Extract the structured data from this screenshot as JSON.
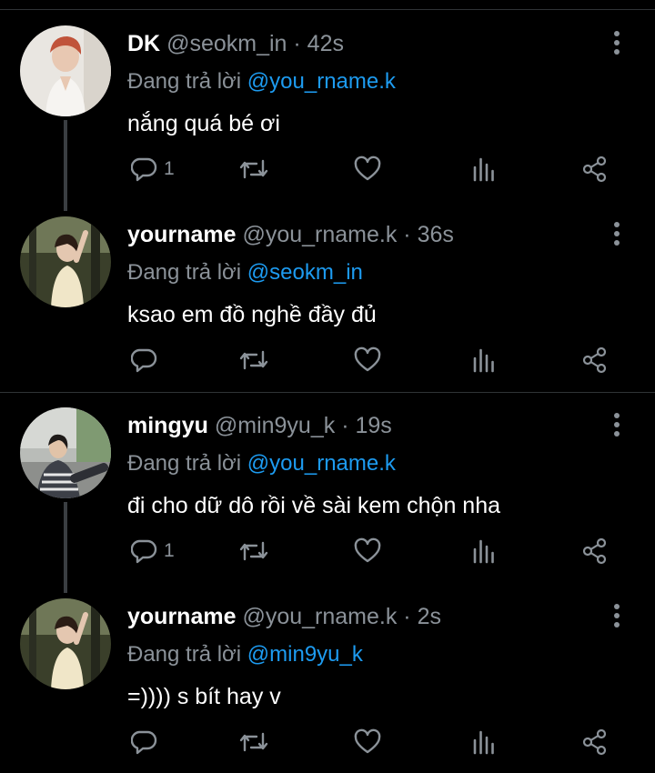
{
  "colors": {
    "background": "#000000",
    "muted": "#8b9299",
    "mention": "#1d9bf0",
    "divider": "#2f3336"
  },
  "tweets": [
    {
      "name": "DK",
      "handle": "@seokm_in",
      "time": "· 42s",
      "reply_prefix": "Đang trả lời",
      "reply_to": "@you_rname.k",
      "text": "nắng quá bé ơi",
      "reply_count": "1",
      "avatar": "avatar-dk"
    },
    {
      "name": "yourname",
      "handle": "@you_rname.k",
      "time": "· 36s",
      "reply_prefix": "Đang trả lời",
      "reply_to": "@seokm_in",
      "text": "ksao em đồ nghề đầy đủ",
      "reply_count": "",
      "avatar": "avatar-yourname"
    },
    {
      "name": "mingyu",
      "handle": "@min9yu_k",
      "time": "· 19s",
      "reply_prefix": "Đang trả lời",
      "reply_to": "@you_rname.k",
      "text": "đi cho dữ dô rồi về sài kem chộn nha",
      "reply_count": "1",
      "avatar": "avatar-mingyu"
    },
    {
      "name": "yourname",
      "handle": "@you_rname.k",
      "time": "· 2s",
      "reply_prefix": "Đang trả lời",
      "reply_to": "@min9yu_k",
      "text": "=)))) s bít hay v",
      "reply_count": "",
      "avatar": "avatar-yourname"
    }
  ],
  "icons": [
    "reply-icon",
    "retweet-icon",
    "like-icon",
    "analytics-icon",
    "share-icon",
    "more-options-icon"
  ]
}
